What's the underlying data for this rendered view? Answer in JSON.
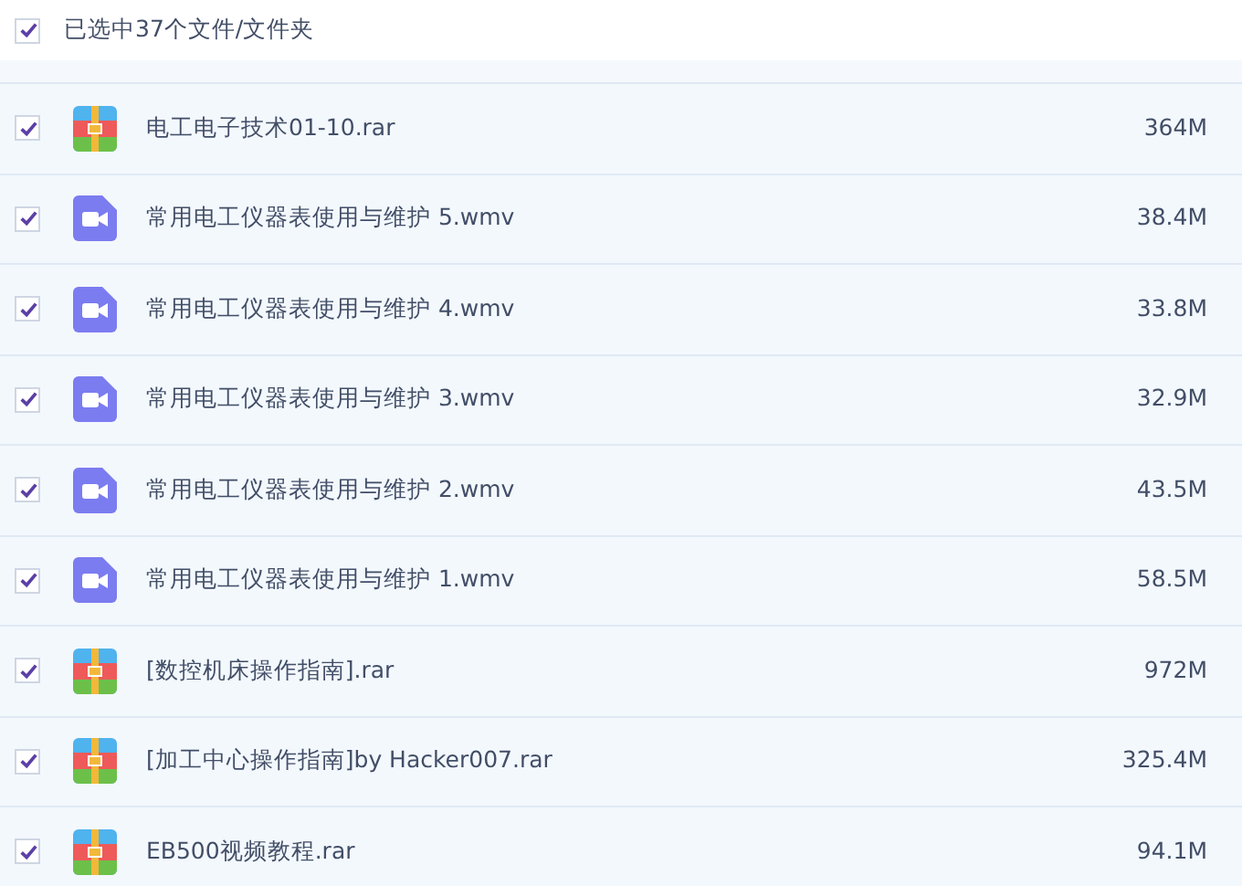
{
  "header": {
    "checked": true,
    "label": "已选中37个文件/文件夹"
  },
  "files": [
    {
      "kind": "archive",
      "name": "电工电子技术01-10.rar",
      "size": "364M",
      "checked": true
    },
    {
      "kind": "video",
      "name": "常用电工仪器表使用与维护 5.wmv",
      "size": "38.4M",
      "checked": true
    },
    {
      "kind": "video",
      "name": "常用电工仪器表使用与维护 4.wmv",
      "size": "33.8M",
      "checked": true
    },
    {
      "kind": "video",
      "name": "常用电工仪器表使用与维护 3.wmv",
      "size": "32.9M",
      "checked": true
    },
    {
      "kind": "video",
      "name": "常用电工仪器表使用与维护 2.wmv",
      "size": "43.5M",
      "checked": true
    },
    {
      "kind": "video",
      "name": "常用电工仪器表使用与维护 1.wmv",
      "size": "58.5M",
      "checked": true
    },
    {
      "kind": "archive",
      "name": "[数控机床操作指南].rar",
      "size": "972M",
      "checked": true
    },
    {
      "kind": "archive",
      "name": "[加工中心操作指南]by Hacker007.rar",
      "size": "325.4M",
      "checked": true
    },
    {
      "kind": "archive",
      "name": "EB500视频教程.rar",
      "size": "94.1M",
      "checked": true
    }
  ]
}
